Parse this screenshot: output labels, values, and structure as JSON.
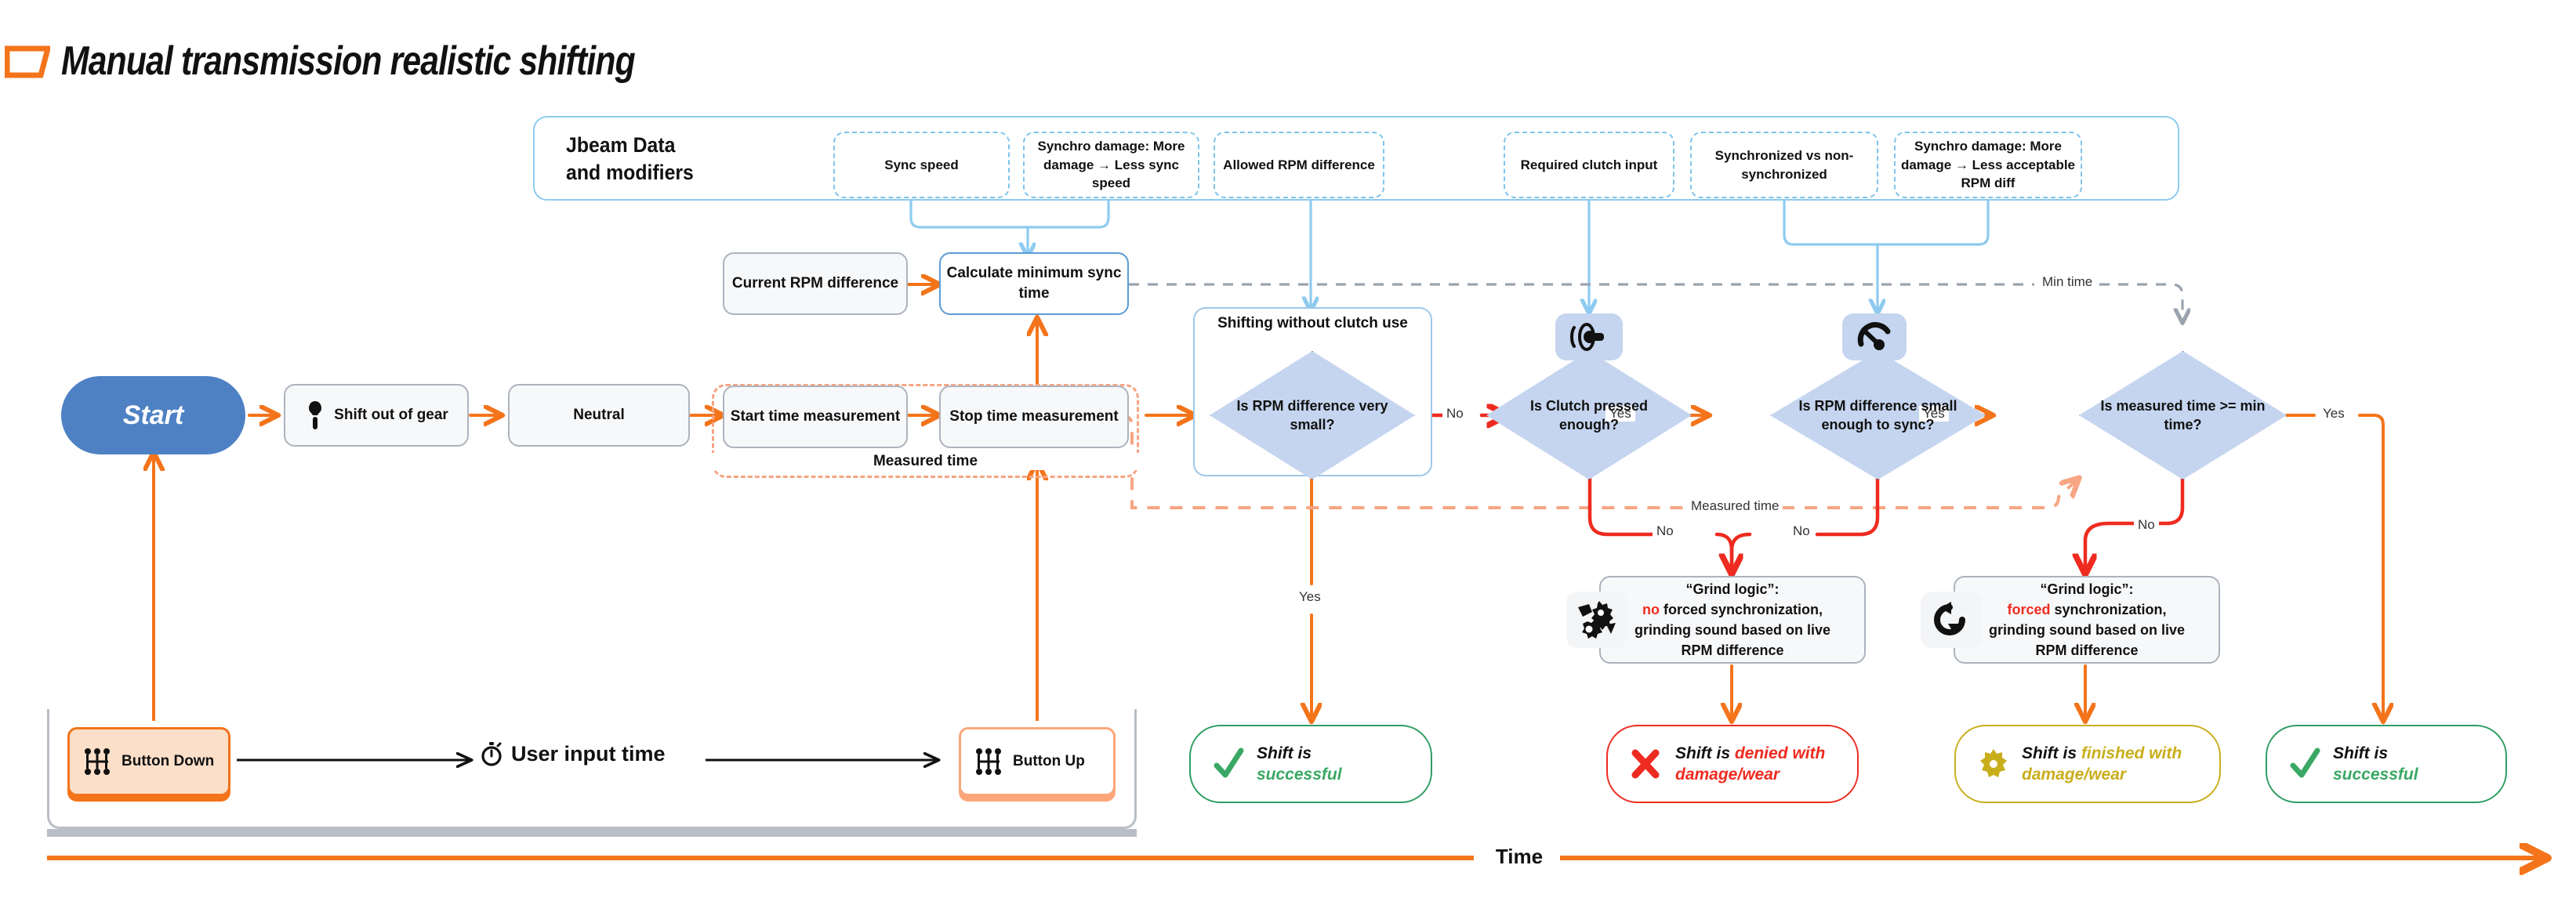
{
  "title": "Manual transmission realistic shifting",
  "jbeam": {
    "panel_title_line1": "Jbeam Data",
    "panel_title_line2": "and modifiers",
    "chips": [
      {
        "name": "sync-speed",
        "text": "Sync speed"
      },
      {
        "name": "synchro-damage-sync",
        "text": "Synchro damage: More damage → Less sync speed"
      },
      {
        "name": "allowed-rpm-difference",
        "text": "Allowed RPM difference"
      },
      {
        "name": "required-clutch-input",
        "text": "Required clutch input"
      },
      {
        "name": "synchronized-vs-non",
        "text": "Synchronized vs non-synchronized"
      },
      {
        "name": "synchro-damage-rpm",
        "text": "Synchro damage: More damage → Less acceptable RPM diff"
      }
    ]
  },
  "nodes": {
    "start": "Start",
    "shift_out_of_gear": "Shift out of gear",
    "neutral": "Neutral",
    "current_rpm_difference": "Current RPM difference",
    "calculate_min_sync_time": "Calculate minimum sync time",
    "start_time_measurement": "Start time measurement",
    "stop_time_measurement": "Stop time measurement",
    "measured_time_group": "Measured time",
    "shifting_without_clutch_group": "Shifting without clutch use"
  },
  "decisions": [
    {
      "name": "is-rpm-difference-very-small",
      "text": "Is RPM difference very small?",
      "icon": null
    },
    {
      "name": "is-clutch-pressed-enough",
      "text": "Is Clutch pressed enough?",
      "icon": "clutch-icon"
    },
    {
      "name": "is-rpm-difference-small-enough-to-sync",
      "text": "Is RPM difference small enough to sync?",
      "icon": "gauge-icon"
    },
    {
      "name": "is-measured-time-min-time",
      "text": "Is measured time >= min time?",
      "icon": null
    }
  ],
  "grind": [
    {
      "name": "grind-logic-no-forced-sync",
      "icon": "broken-gears-icon",
      "line1": "“Grind logic”:",
      "highlight": "no",
      "line2_rest": " forced synchronization,",
      "line3": "grinding sound based on live",
      "line4": "RPM difference"
    },
    {
      "name": "grind-logic-forced-sync",
      "icon": "sync-arrow-icon",
      "line1": "“Grind logic”:",
      "highlight": "forced",
      "line2_rest": " synchronization,",
      "line3": "grinding sound based on live",
      "line4": "RPM difference"
    }
  ],
  "results": [
    {
      "name": "result-shift-successful-1",
      "icon": "check-icon",
      "color": "green",
      "lead": "Shift is",
      "tail": "successful"
    },
    {
      "name": "result-shift-denied",
      "icon": "cross-icon",
      "color": "red",
      "lead": "Shift is ",
      "tail": "denied with damage/wear"
    },
    {
      "name": "result-shift-finished-damage",
      "icon": "gear-icon",
      "color": "yellow",
      "lead": "Shift is ",
      "tail": "finished with damage/wear"
    },
    {
      "name": "result-shift-successful-2",
      "icon": "check-icon",
      "color": "green",
      "lead": "Shift is",
      "tail": "successful"
    }
  ],
  "timeline": {
    "button_down": "Button Down",
    "button_up": "Button Up",
    "user_input_time": "User input time",
    "axis_label": "Time",
    "stopwatch_icon": "stopwatch-icon",
    "gear_stick_icon": "gear-stick-icon"
  },
  "edge_labels": {
    "no": "No",
    "yes": "Yes",
    "min_time": "Min time",
    "measured_time": "Measured time"
  },
  "colors": {
    "orange": "#f4741b",
    "red": "#ee2b20",
    "blue_light": "#8ecbf0",
    "diamond_fill": "#c5d5ef",
    "start_blue": "#4e81c4",
    "green": "#2f9e63",
    "yellow": "#c9ae1b",
    "gray_dash": "#9aa3ae"
  }
}
